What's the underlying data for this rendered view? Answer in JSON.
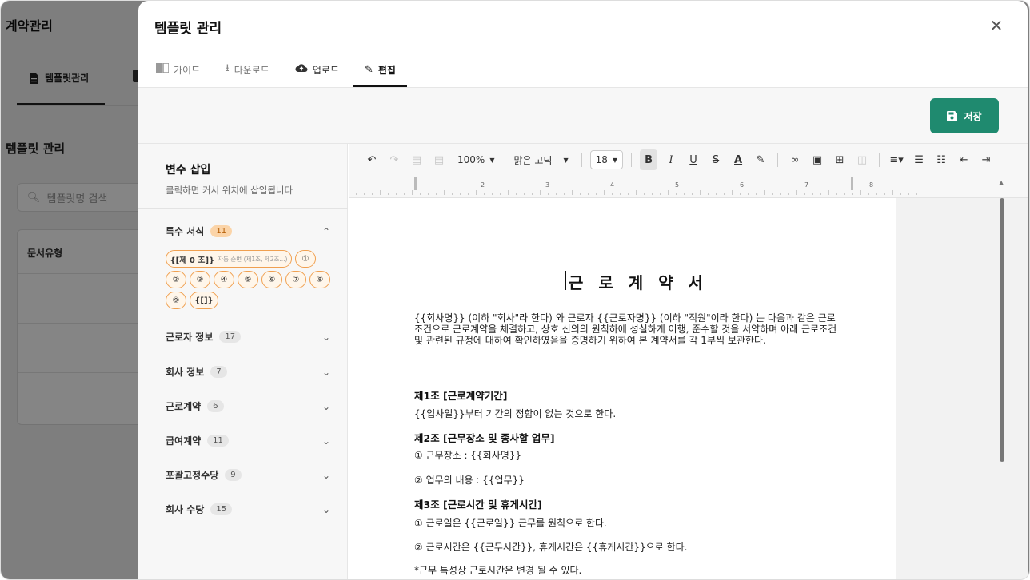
{
  "background": {
    "title": "계약관리",
    "tab_label": "템플릿관리",
    "section_title": "템플릿 관리",
    "search_placeholder": "템플릿명 검색",
    "table_header": "문서유형"
  },
  "modal": {
    "title": "템플릿 관리",
    "close_icon": "✕",
    "tabs": [
      {
        "label": "가이드",
        "icon": "book-icon"
      },
      {
        "label": "다운로드",
        "icon": "download-icon"
      },
      {
        "label": "업로드",
        "icon": "cloud-upload-icon"
      },
      {
        "label": "편집",
        "icon": "pencil-icon",
        "active": true
      }
    ],
    "save_label": "저장"
  },
  "variables": {
    "title": "변수 삽입",
    "subtitle": "클릭하면 커서 위치에 삽입됩니다",
    "categories": [
      {
        "label": "특수 서식",
        "count": "11",
        "expanded": true
      },
      {
        "label": "근로자 정보",
        "count": "17"
      },
      {
        "label": "회사 정보",
        "count": "7"
      },
      {
        "label": "근로계약",
        "count": "6"
      },
      {
        "label": "급여계약",
        "count": "11"
      },
      {
        "label": "포괄고정수당",
        "count": "9"
      },
      {
        "label": "회사 수당",
        "count": "15"
      }
    ],
    "chips": {
      "article": "{[제 0 조]}",
      "article_hint": "자동 순번 (제1조, 제2조...)",
      "c1": "①",
      "c2": "②",
      "c3": "③",
      "c4": "④",
      "c5": "⑤",
      "c6": "⑥",
      "c7": "⑦",
      "c8": "⑧",
      "c9": "⑨",
      "bracket": "{[]}"
    }
  },
  "toolbar": {
    "zoom": "100%",
    "font": "맑은 고딕",
    "size": "18",
    "bold": "B",
    "italic": "I",
    "underline": "U",
    "strike": "S",
    "color": "A"
  },
  "ruler": {
    "numbers": [
      "2",
      "3",
      "4",
      "5",
      "6",
      "7",
      "8"
    ]
  },
  "document": {
    "title": "근 로 계 약 서",
    "intro": "{{회사명}} (이하 \"회사\"라 한다) 와 근로자 {{근로자명}} (이하 \"직원\"이라 한다) 는 다음과 같은 근로조건으로 근로계약을 체결하고, 상호 신의의 원칙하에 성실하게 이행, 준수할 것을 서약하며 아래 근로조건 및 관련된 규정에 대하여 확인하였음을 증명하기 위하여 본 계약서를 각 1부씩 보관한다.",
    "art1_title": "제1조 [근로계약기간]",
    "art1_text": "{{입사일}}부터 기간의 정함이 없는 것으로 한다.",
    "art2_title": "제2조 [근무장소 및 종사할 업무]",
    "art2_l1": "① 근무장소 : {{회사명}}",
    "art2_l2": "② 업무의 내용 : {{업무}}",
    "art3_title": "제3조 [근로시간 및 휴게시간]",
    "art3_l1": "① 근로일은 {{근로일}} 근무를 원칙으로 한다.",
    "art3_l2": "② 근로시간은 {{근무시간}}, 휴게시간은 {{휴게시간}}으로 한다.",
    "art3_l3": "*근무 특성상 근로시간은 변경 될 수 있다."
  }
}
